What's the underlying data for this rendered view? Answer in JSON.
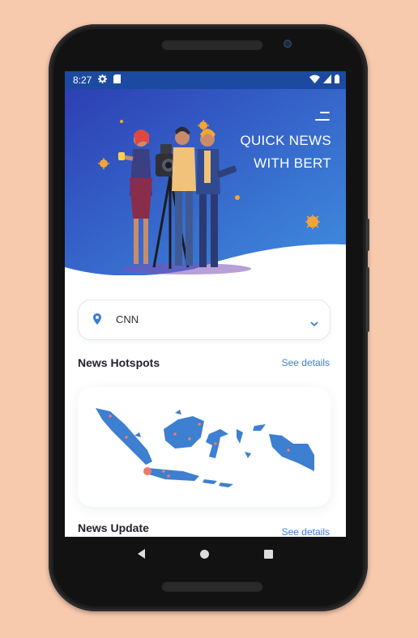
{
  "status_bar": {
    "time": "8:27",
    "icons": [
      "gear-icon",
      "sd-card-icon",
      "wifi-icon",
      "signal-icon",
      "battery-icon"
    ]
  },
  "hero": {
    "title_line1": "QUICK NEWS",
    "title_line2": "WITH BERT",
    "gradient_start": "#2d3fb4",
    "gradient_end": "#3f8ee0"
  },
  "source_select": {
    "value": "CNN",
    "accent": "#3b7bd6"
  },
  "hotspots": {
    "title": "News Hotspots",
    "link": "See details"
  },
  "updates": {
    "title": "News Update",
    "link": "See details"
  },
  "colors": {
    "background": "#f7c9ad",
    "map_fill": "#3d7fd1",
    "map_dot": "#f07a6a"
  }
}
